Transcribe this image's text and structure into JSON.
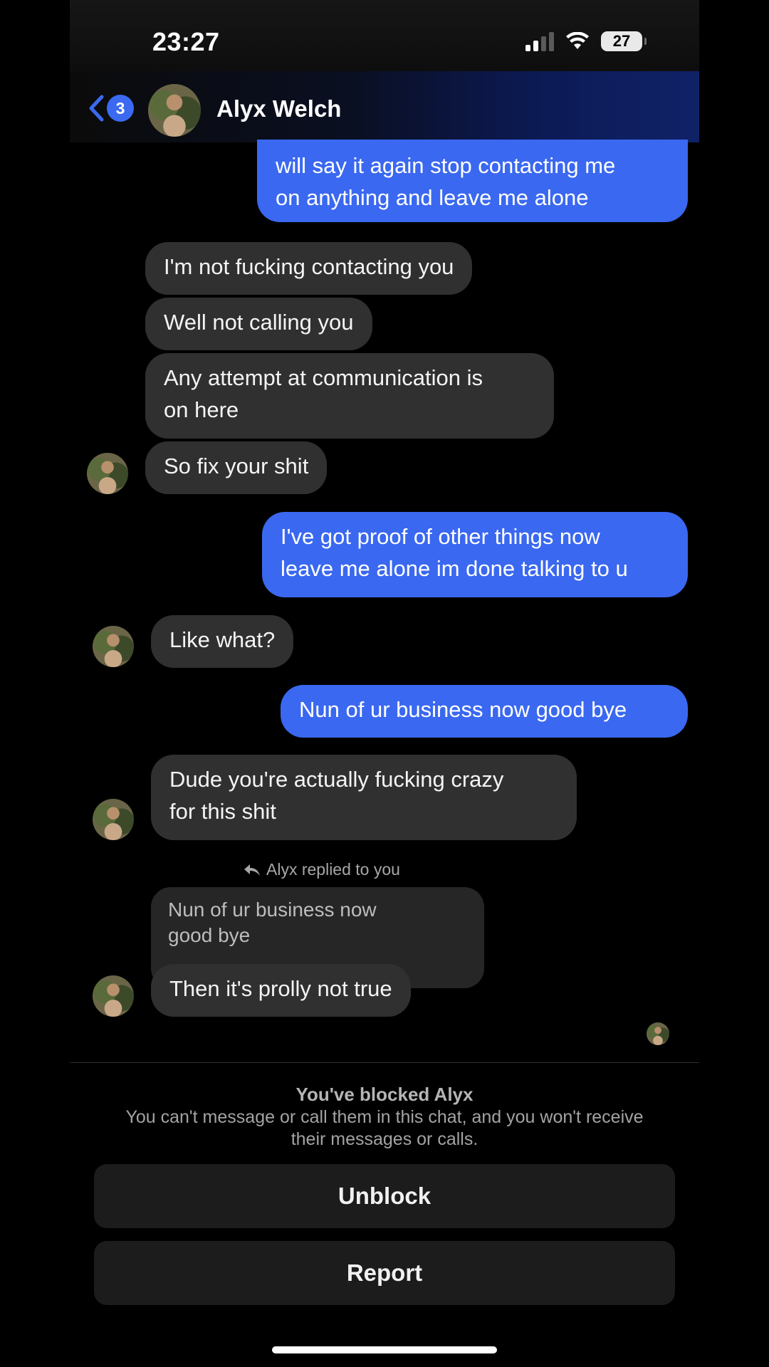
{
  "status_bar": {
    "time": "23:27",
    "battery": "27",
    "signal_bars_active": 2,
    "signal_bars_total": 4
  },
  "header": {
    "back_badge": "3",
    "contact_name": "Alyx Welch"
  },
  "messages": [
    {
      "from": "me",
      "text": [
        "will say it again stop contacting me",
        "on anything and leave me alone"
      ]
    },
    {
      "from": "them",
      "text": [
        "I'm not fucking contacting you"
      ]
    },
    {
      "from": "them",
      "text": [
        "Well not calling you"
      ]
    },
    {
      "from": "them",
      "text": [
        "Any attempt at communication is",
        "on here"
      ]
    },
    {
      "from": "them",
      "text": [
        "So fix your shit"
      ]
    },
    {
      "from": "me",
      "text": [
        "I've got proof of other things now",
        "leave me alone im done talking to u"
      ]
    },
    {
      "from": "them",
      "text": [
        "Like what?"
      ]
    },
    {
      "from": "me",
      "text": [
        "Nun of ur business now good bye"
      ]
    },
    {
      "from": "them",
      "text": [
        "Dude you're actually fucking crazy",
        "for this shit"
      ]
    },
    {
      "from": "them",
      "text": [
        "Then it's prolly not true"
      ]
    }
  ],
  "reply": {
    "label": "Alyx replied to you",
    "quoted": [
      "Nun of ur business now",
      "good bye"
    ]
  },
  "blocked": {
    "title": "You've blocked Alyx",
    "description": "You can't message or call them in this chat, and you won't receive their messages or calls."
  },
  "buttons": {
    "unblock": "Unblock",
    "report": "Report"
  },
  "colors": {
    "outgoing_bubble": "#3a68f0",
    "incoming_bubble": "#303030",
    "accent": "#3b6af0"
  }
}
